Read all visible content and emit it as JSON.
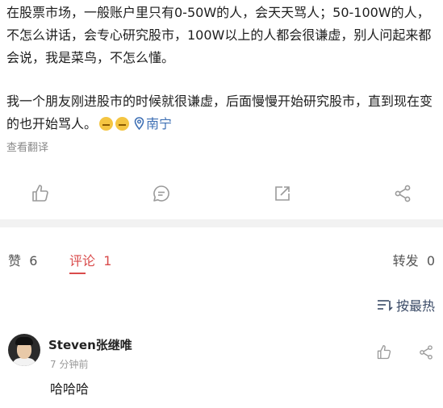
{
  "post": {
    "paragraph1": "在股票市场，一般账户里只有0-50W的人，会天天骂人；50-100W的人，不怎么讲话，会专心研究股市，100W以上的人都会很谦虚，别人问起来都会说，我是菜鸟，不怎么懂。",
    "paragraph2": "我一个朋友刚进股市的时候就很谦虚，后面慢慢开始研究股市，直到现在变的也开始骂人。",
    "location": "南宁",
    "translate_label": "查看翻译"
  },
  "stats": {
    "likes_label": "赞",
    "likes_count": "6",
    "comments_label": "评论",
    "comments_count": "1",
    "reposts_label": "转发",
    "reposts_count": "0"
  },
  "sort": {
    "label": "按最热"
  },
  "comment": {
    "author": "Steven张继唯",
    "time": "7 分钟前",
    "text": "哈哈哈"
  },
  "colors": {
    "accent": "#d94b4b",
    "link": "#3d6fb4",
    "icon": "#9a9a9a"
  }
}
